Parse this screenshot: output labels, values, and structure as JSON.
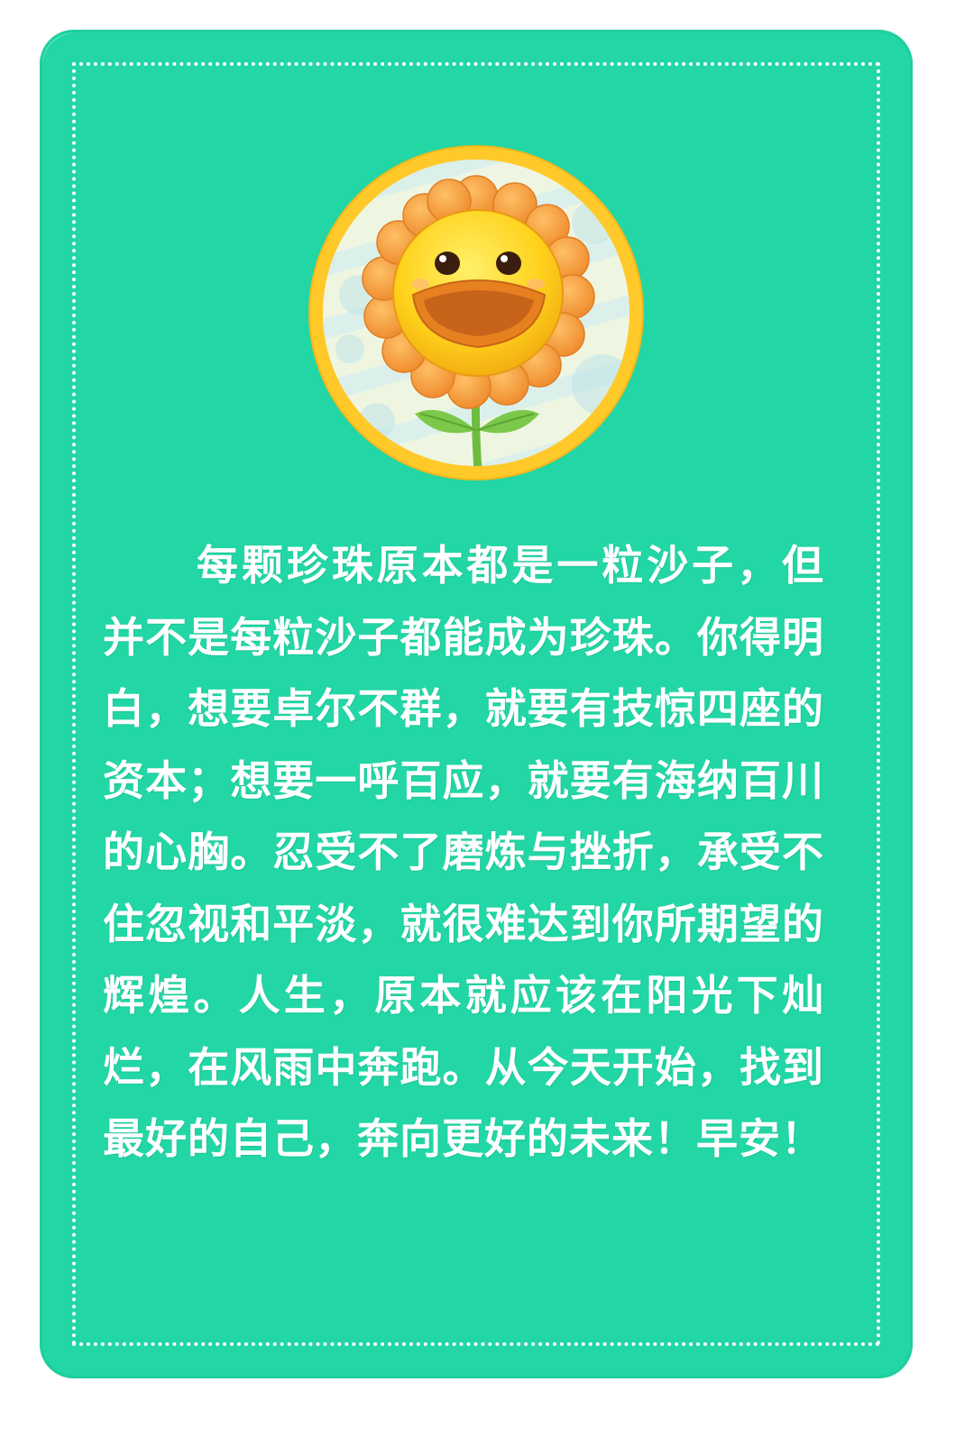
{
  "colors": {
    "background": "#ffffff",
    "card": "#22d6a5",
    "frame": "#ffffff",
    "avatar_ring": "#ffc92a",
    "petals": "#f39a3a",
    "face": "#ffd21c",
    "text": "#ffffff"
  },
  "illustration": {
    "subject": "sunflower-icon"
  },
  "quote": {
    "text": "每颗珍珠原本都是一粒沙子，但并不是每粒沙子都能成为珍珠。你得明白，想要卓尔不群，就要有技惊四座的资本；想要一呼百应，就要有海纳百川的心胸。忍受不了磨炼与挫折，承受不住忽视和平淡，就很难达到你所期望的辉煌。人生，原本就应该在阳光下灿烂，在风雨中奔跑。从今天开始，找到最好的自己，奔向更好的未来！早安！"
  }
}
